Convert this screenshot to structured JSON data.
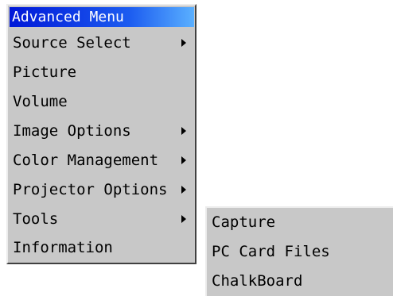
{
  "menu": {
    "title": "Advanced Menu",
    "items": [
      {
        "label": "Source Select",
        "has_submenu": true
      },
      {
        "label": "Picture",
        "has_submenu": false
      },
      {
        "label": "Volume",
        "has_submenu": false
      },
      {
        "label": "Image Options",
        "has_submenu": true
      },
      {
        "label": "Color Management",
        "has_submenu": true
      },
      {
        "label": "Projector Options",
        "has_submenu": true
      },
      {
        "label": "Tools",
        "has_submenu": true
      },
      {
        "label": "Information",
        "has_submenu": false
      }
    ]
  },
  "submenu": {
    "parent": "Tools",
    "items": [
      {
        "label": "Capture"
      },
      {
        "label": "PC Card Files"
      },
      {
        "label": "ChalkBoard"
      }
    ]
  },
  "colors": {
    "menu_background": "#c8c8c8",
    "title_gradient_start": "#0018d8",
    "title_gradient_end": "#5ab0ff",
    "title_text": "#ffffff",
    "item_text": "#000000"
  },
  "icons": {
    "submenu_indicator": "triangle-right-icon"
  }
}
